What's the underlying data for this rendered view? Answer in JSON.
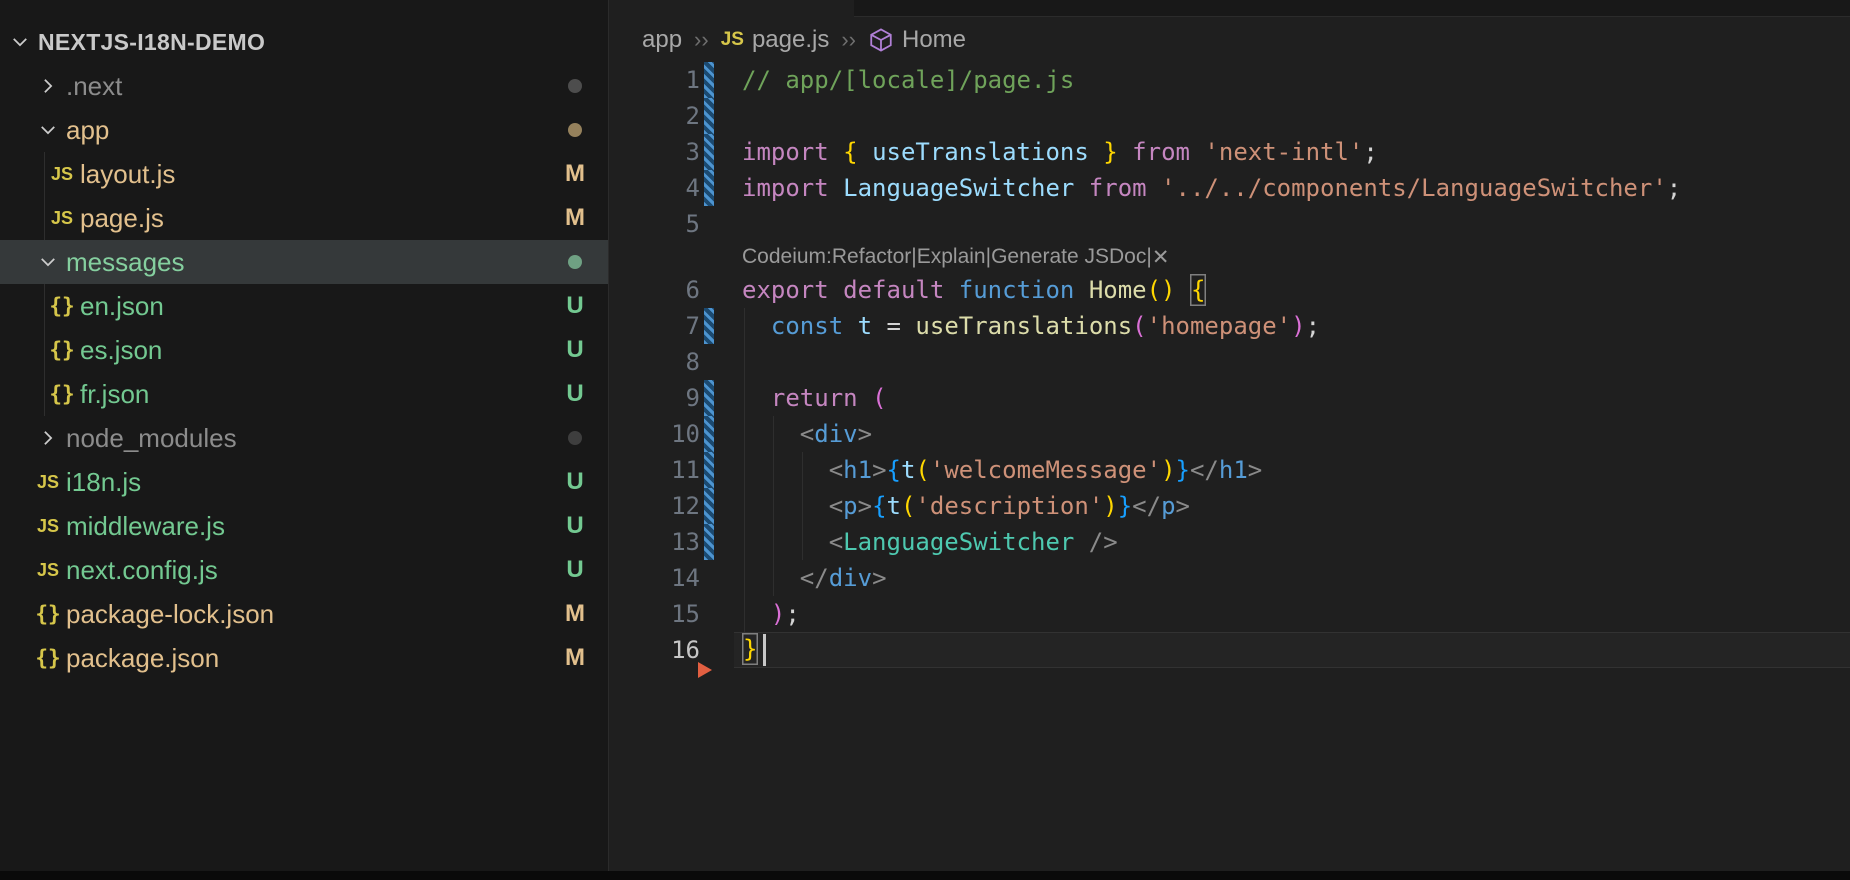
{
  "theme": {
    "sidebar_bg": "#181818",
    "editor_bg": "#1f1f1f",
    "border": "#2b2b2b",
    "modified": "#e2c08d",
    "untracked": "#73c991",
    "ignored": "#8c8c8c",
    "selected_row": "#35393a",
    "bracket_gold": "#ffd700",
    "bracket_orchid": "#da70d6",
    "bracket_blue": "#179fff",
    "gutter_modified_blue": "#4d94d0",
    "marker_red": "#e25f41",
    "symbol_module_purple": "#b180d7",
    "js_icon_yellow": "#d6c64a"
  },
  "sidebar": {
    "title": "NEXTJS-I18N-DEMO",
    "badge_colors": {
      "M": "#e2c08d",
      "U": "#73c991"
    },
    "items": [
      {
        "label": ".next",
        "type": "folder",
        "expanded": false,
        "depth": 0,
        "fg": "ignored",
        "badge": "dot",
        "dot": "#4d4d4d"
      },
      {
        "label": "app",
        "type": "folder",
        "expanded": true,
        "depth": 0,
        "fg": "modified",
        "badge": "dot",
        "dot": "#95815c"
      },
      {
        "label": "layout.js",
        "type": "file",
        "icon": "js",
        "depth": 1,
        "fg": "modified",
        "badge": "M"
      },
      {
        "label": "page.js",
        "type": "file",
        "icon": "js",
        "depth": 1,
        "fg": "modified",
        "badge": "M"
      },
      {
        "label": "messages",
        "type": "folder",
        "expanded": true,
        "depth": 0,
        "fg": "untracked",
        "badge": "dot",
        "dot": "#6fa183",
        "selected": true
      },
      {
        "label": "en.json",
        "type": "file",
        "icon": "json",
        "depth": 1,
        "fg": "untracked",
        "badge": "U"
      },
      {
        "label": "es.json",
        "type": "file",
        "icon": "json",
        "depth": 1,
        "fg": "untracked",
        "badge": "U"
      },
      {
        "label": "fr.json",
        "type": "file",
        "icon": "json",
        "depth": 1,
        "fg": "untracked",
        "badge": "U"
      },
      {
        "label": "node_modules",
        "type": "folder",
        "expanded": false,
        "depth": 0,
        "fg": "ignored",
        "badge": "dot",
        "dot": "#3e3e3e"
      },
      {
        "label": "i18n.js",
        "type": "file",
        "icon": "js",
        "depth": 0,
        "fg": "untracked",
        "badge": "U"
      },
      {
        "label": "middleware.js",
        "type": "file",
        "icon": "js",
        "depth": 0,
        "fg": "untracked",
        "badge": "U"
      },
      {
        "label": "next.config.js",
        "type": "file",
        "icon": "js",
        "depth": 0,
        "fg": "untracked",
        "badge": "U"
      },
      {
        "label": "package-lock.json",
        "type": "file",
        "icon": "json",
        "depth": 0,
        "fg": "modified",
        "badge": "M"
      },
      {
        "label": "package.json",
        "type": "file",
        "icon": "json",
        "depth": 0,
        "fg": "modified",
        "badge": "M"
      }
    ]
  },
  "breadcrumb": {
    "items": [
      {
        "label": "app"
      },
      {
        "label": "page.js",
        "icon": "js"
      },
      {
        "label": "Home",
        "icon": "module"
      }
    ]
  },
  "editor": {
    "codelens": {
      "prefix": "Codeium:",
      "actions": [
        "Refactor",
        "Explain",
        "Generate JSDoc"
      ],
      "separator": " | ",
      "close": "✕"
    },
    "rows": [
      {
        "type": "line",
        "n": 1,
        "mod": true,
        "tokens": [
          [
            "c",
            "// app/[locale]/page.js"
          ]
        ]
      },
      {
        "type": "line",
        "n": 2,
        "mod": true,
        "tokens": []
      },
      {
        "type": "line",
        "n": 3,
        "mod": true,
        "tokens": [
          [
            "k",
            "import"
          ],
          [
            "p",
            " "
          ],
          [
            "bg",
            "{"
          ],
          [
            "p",
            " "
          ],
          [
            "v",
            "useTranslations"
          ],
          [
            "p",
            " "
          ],
          [
            "bg",
            "}"
          ],
          [
            "p",
            " "
          ],
          [
            "k",
            "from"
          ],
          [
            "p",
            " "
          ],
          [
            "s",
            "'next-intl'"
          ],
          [
            "p",
            ";"
          ]
        ]
      },
      {
        "type": "line",
        "n": 4,
        "mod": true,
        "tokens": [
          [
            "k",
            "import"
          ],
          [
            "p",
            " "
          ],
          [
            "v",
            "LanguageSwitcher"
          ],
          [
            "p",
            " "
          ],
          [
            "k",
            "from"
          ],
          [
            "p",
            " "
          ],
          [
            "s",
            "'../../components/LanguageSwitcher'"
          ],
          [
            "p",
            ";"
          ]
        ]
      },
      {
        "type": "line",
        "n": 5,
        "mod": false,
        "tokens": []
      },
      {
        "type": "lens"
      },
      {
        "type": "line",
        "n": 6,
        "mod": false,
        "tokens": [
          [
            "k",
            "export"
          ],
          [
            "p",
            " "
          ],
          [
            "k",
            "default"
          ],
          [
            "p",
            " "
          ],
          [
            "kb",
            "function"
          ],
          [
            "p",
            " "
          ],
          [
            "f",
            "Home"
          ],
          [
            "bg",
            "()"
          ],
          [
            "p",
            " "
          ],
          [
            "mbg",
            "{"
          ]
        ]
      },
      {
        "type": "line",
        "n": 7,
        "mod": true,
        "tokens": [
          [
            "p",
            "  "
          ],
          [
            "kb",
            "const"
          ],
          [
            "p",
            " "
          ],
          [
            "v",
            "t"
          ],
          [
            "p",
            " = "
          ],
          [
            "f",
            "useTranslations"
          ],
          [
            "bo",
            "("
          ],
          [
            "s",
            "'homepage'"
          ],
          [
            "bo",
            ")"
          ],
          [
            "p",
            ";"
          ]
        ]
      },
      {
        "type": "line",
        "n": 8,
        "mod": false,
        "tokens": []
      },
      {
        "type": "line",
        "n": 9,
        "mod": true,
        "tokens": [
          [
            "p",
            "  "
          ],
          [
            "k",
            "return"
          ],
          [
            "p",
            " "
          ],
          [
            "bo",
            "("
          ]
        ]
      },
      {
        "type": "line",
        "n": 10,
        "mod": true,
        "tokens": [
          [
            "p",
            "    "
          ],
          [
            "a",
            "<"
          ],
          [
            "tg",
            "div"
          ],
          [
            "a",
            ">"
          ]
        ]
      },
      {
        "type": "line",
        "n": 11,
        "mod": true,
        "tokens": [
          [
            "p",
            "      "
          ],
          [
            "a",
            "<"
          ],
          [
            "tg",
            "h1"
          ],
          [
            "a",
            ">"
          ],
          [
            "bb",
            "{"
          ],
          [
            "v",
            "t"
          ],
          [
            "bg",
            "("
          ],
          [
            "s",
            "'welcomeMessage'"
          ],
          [
            "bg",
            ")"
          ],
          [
            "bb",
            "}"
          ],
          [
            "a",
            "</"
          ],
          [
            "tg",
            "h1"
          ],
          [
            "a",
            ">"
          ]
        ]
      },
      {
        "type": "line",
        "n": 12,
        "mod": true,
        "tokens": [
          [
            "p",
            "      "
          ],
          [
            "a",
            "<"
          ],
          [
            "tg",
            "p"
          ],
          [
            "a",
            ">"
          ],
          [
            "bb",
            "{"
          ],
          [
            "v",
            "t"
          ],
          [
            "bg",
            "("
          ],
          [
            "s",
            "'description'"
          ],
          [
            "bg",
            ")"
          ],
          [
            "bb",
            "}"
          ],
          [
            "a",
            "</"
          ],
          [
            "tg",
            "p"
          ],
          [
            "a",
            ">"
          ]
        ]
      },
      {
        "type": "line",
        "n": 13,
        "mod": true,
        "tokens": [
          [
            "p",
            "      "
          ],
          [
            "a",
            "<"
          ],
          [
            "cp",
            "LanguageSwitcher"
          ],
          [
            "p",
            " "
          ],
          [
            "a",
            "/>"
          ]
        ]
      },
      {
        "type": "line",
        "n": 14,
        "mod": false,
        "tokens": [
          [
            "p",
            "    "
          ],
          [
            "a",
            "</"
          ],
          [
            "tg",
            "div"
          ],
          [
            "a",
            ">"
          ]
        ]
      },
      {
        "type": "line",
        "n": 15,
        "mod": false,
        "tokens": [
          [
            "p",
            "  "
          ],
          [
            "bo",
            ")"
          ],
          [
            "p",
            ";"
          ]
        ]
      },
      {
        "type": "line",
        "n": 16,
        "mod": false,
        "current": true,
        "cursor": true,
        "tokens": [
          [
            "mbg",
            "}"
          ]
        ]
      }
    ]
  }
}
